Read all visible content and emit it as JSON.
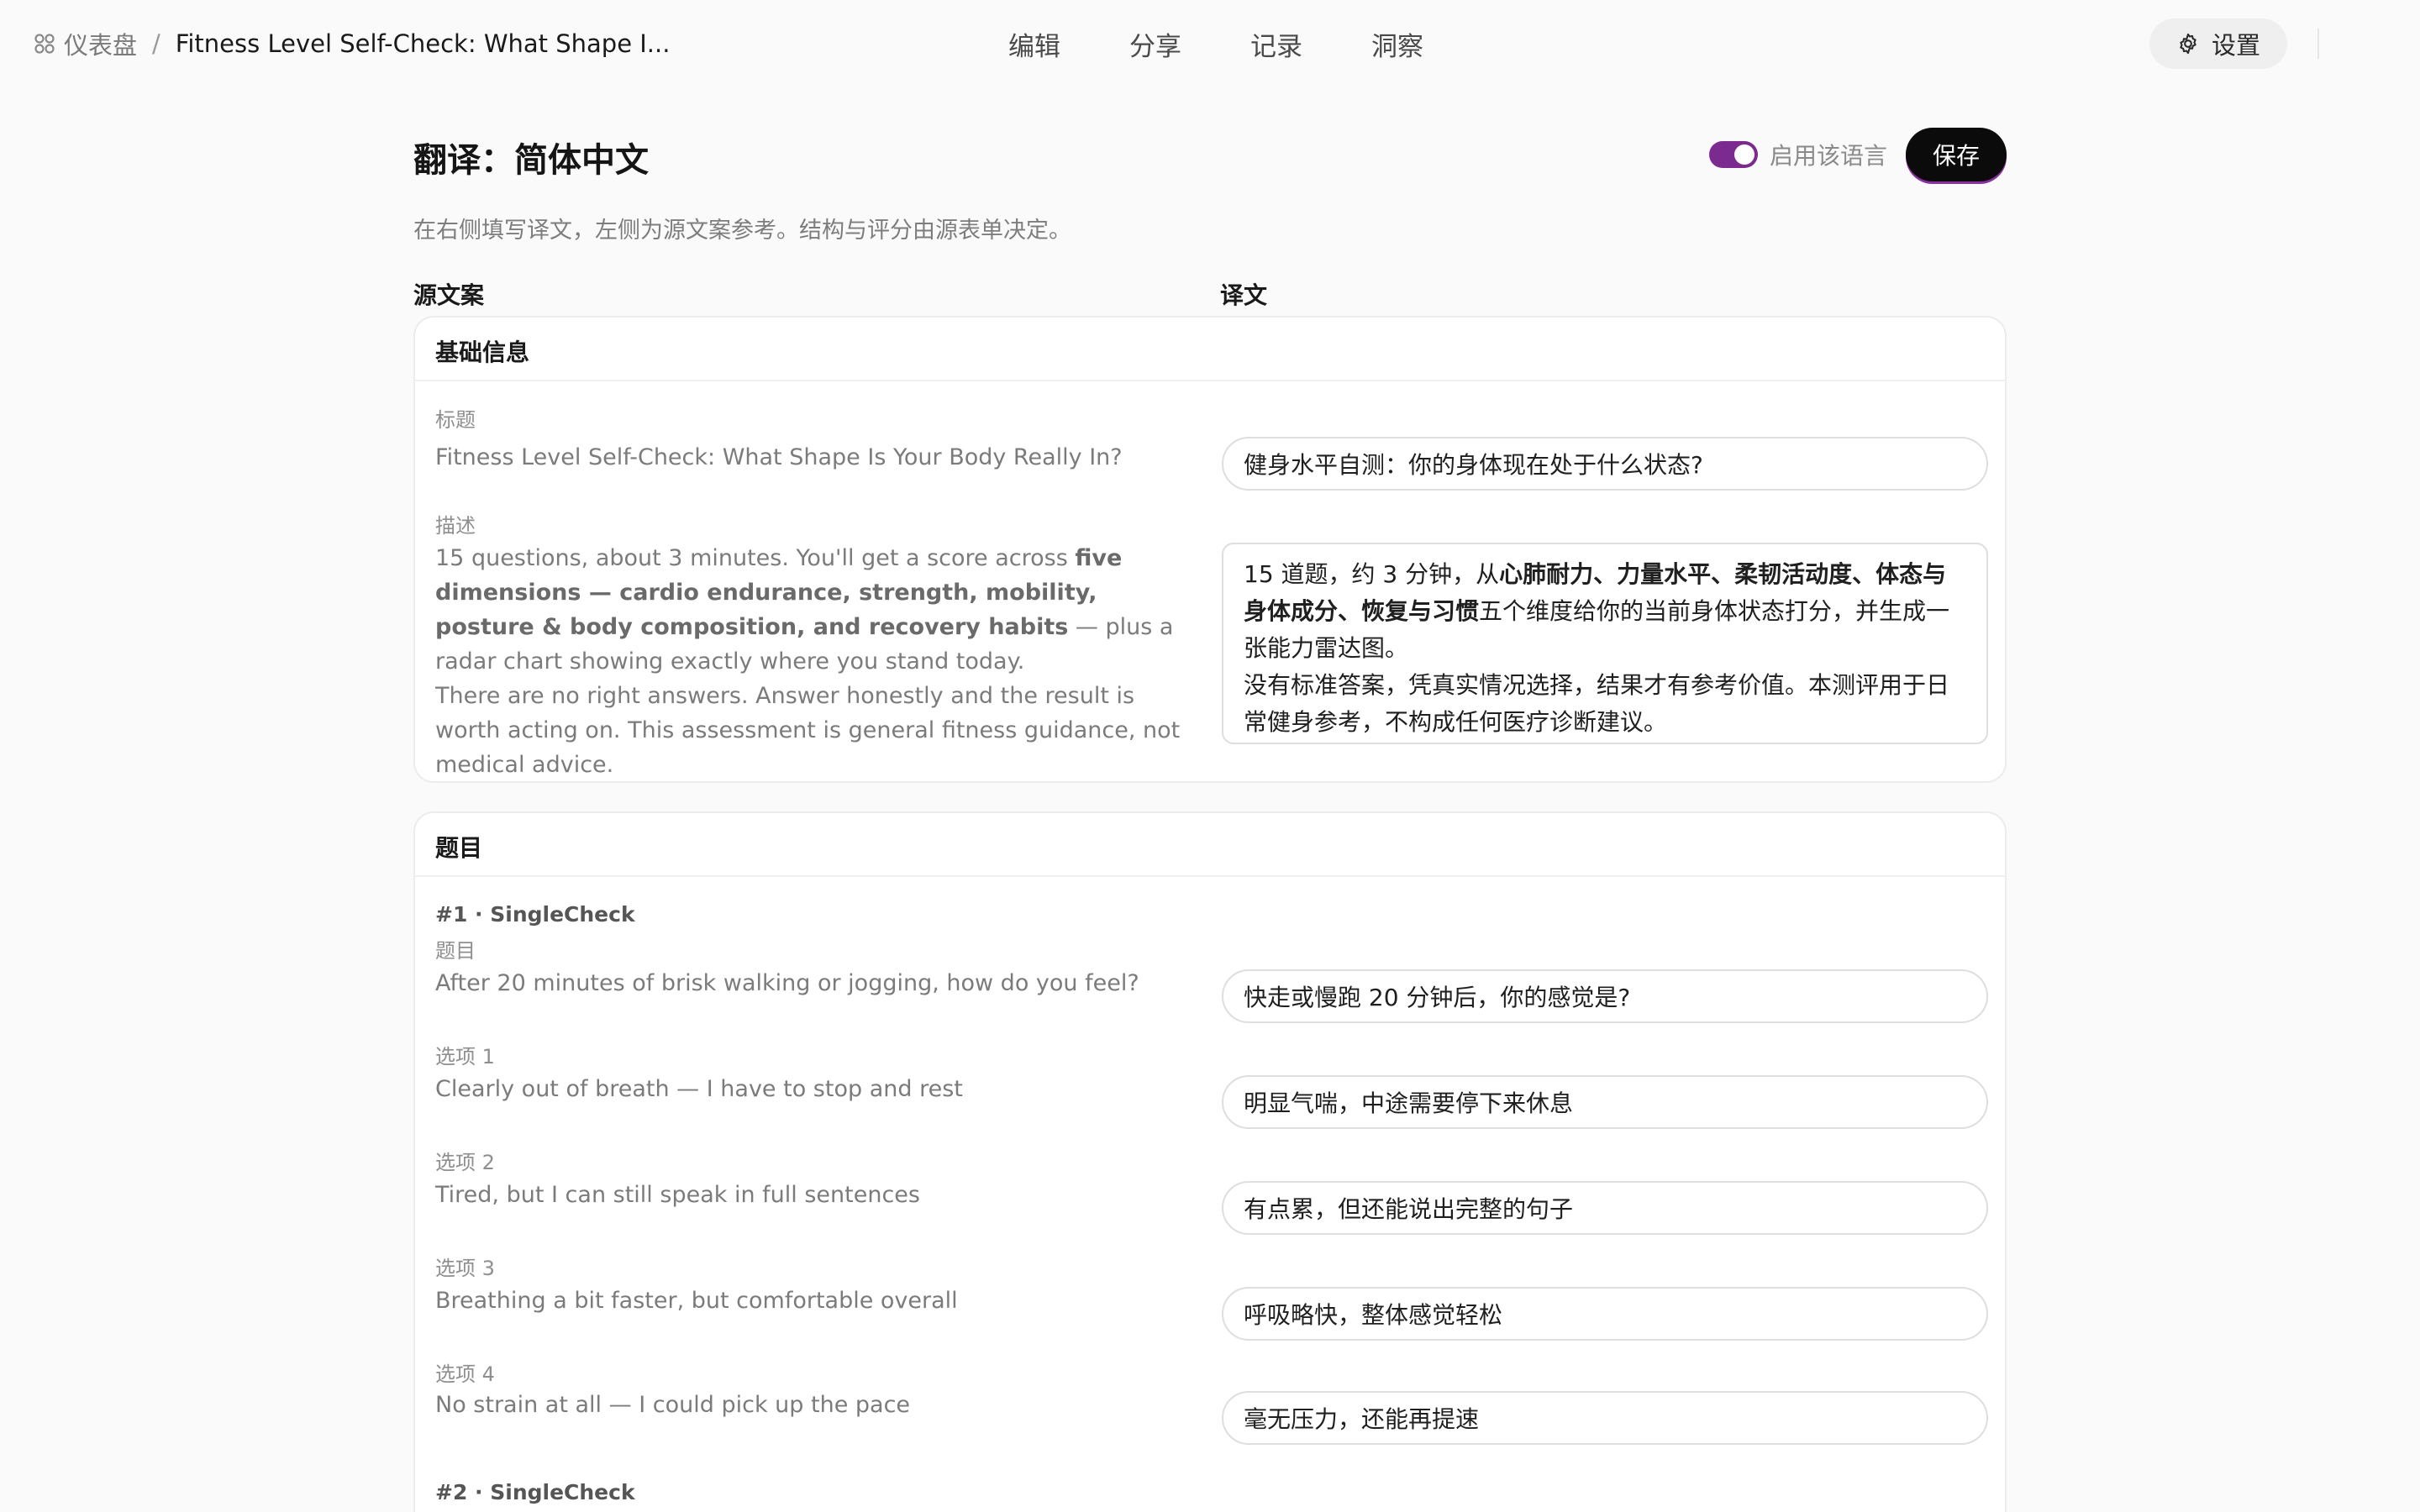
{
  "breadcrumb": {
    "dashboard": "仪表盘",
    "separator": "/",
    "current": "Fitness Level Self-Check: What Shape I..."
  },
  "nav": {
    "tabs": [
      "编辑",
      "分享",
      "记录",
      "洞察"
    ]
  },
  "settings": {
    "label": "设置",
    "icon": "gear-icon"
  },
  "page": {
    "title": "翻译：简体中文",
    "subtitle": "在右侧填写译文，左侧为源文案参考。结构与评分由源表单决定。",
    "enable_label": "启用该语言",
    "enabled": true,
    "save_label": "保存"
  },
  "columns": {
    "source": "源文案",
    "target": "译文"
  },
  "colors": {
    "accent": "#7b2a8f",
    "primary_button": "#0b0b0b"
  },
  "basic": {
    "title": "基础信息",
    "title_label": "标题",
    "title_source": "Fitness Level Self-Check: What Shape Is Your Body Really In?",
    "title_translation": "健身水平自测：你的身体现在处于什么状态?",
    "desc_label": "描述",
    "desc_source": {
      "p1_a": "15 questions, about 3 minutes. You'll get a score across ",
      "p1_b": "five dimensions — cardio endurance, strength, mobility, posture & body composition, and recovery habits",
      "p1_c": " — plus a radar chart showing exactly where you stand today.",
      "p2": "There are no right answers. Answer honestly and the result is worth acting on. This assessment is general fitness guidance, not medical advice."
    },
    "desc_translation": {
      "l1_a": "15 道题，约 3 分钟，从",
      "l1_b": "心肺耐力、力量水平、柔韧活动度、体态与身体成分、恢复与习惯",
      "l1_c": "五个维度给你的当前身体状态打分，并生成一张能力雷达图。",
      "l2": "没有标准答案，凭真实情况选择，结果才有参考价值。本测评用于日常健身参考，不构成任何医疗诊断建议。"
    }
  },
  "questions": {
    "title": "题目",
    "q1": {
      "head": "#1 · SingleCheck",
      "question_label": "题目",
      "question_source": "After 20 minutes of brisk walking or jogging, how do you feel?",
      "question_translation": "快走或慢跑 20 分钟后，你的感觉是?",
      "options": [
        {
          "label": "选项 1",
          "source": "Clearly out of breath — I have to stop and rest",
          "translation": "明显气喘，中途需要停下来休息"
        },
        {
          "label": "选项 2",
          "source": "Tired, but I can still speak in full sentences",
          "translation": "有点累，但还能说出完整的句子"
        },
        {
          "label": "选项 3",
          "source": "Breathing a bit faster, but comfortable overall",
          "translation": "呼吸略快，整体感觉轻松"
        },
        {
          "label": "选项 4",
          "source": "No strain at all — I could pick up the pace",
          "translation": "毫无压力，还能再提速"
        }
      ]
    },
    "q2": {
      "head": "#2 · SingleCheck"
    }
  }
}
